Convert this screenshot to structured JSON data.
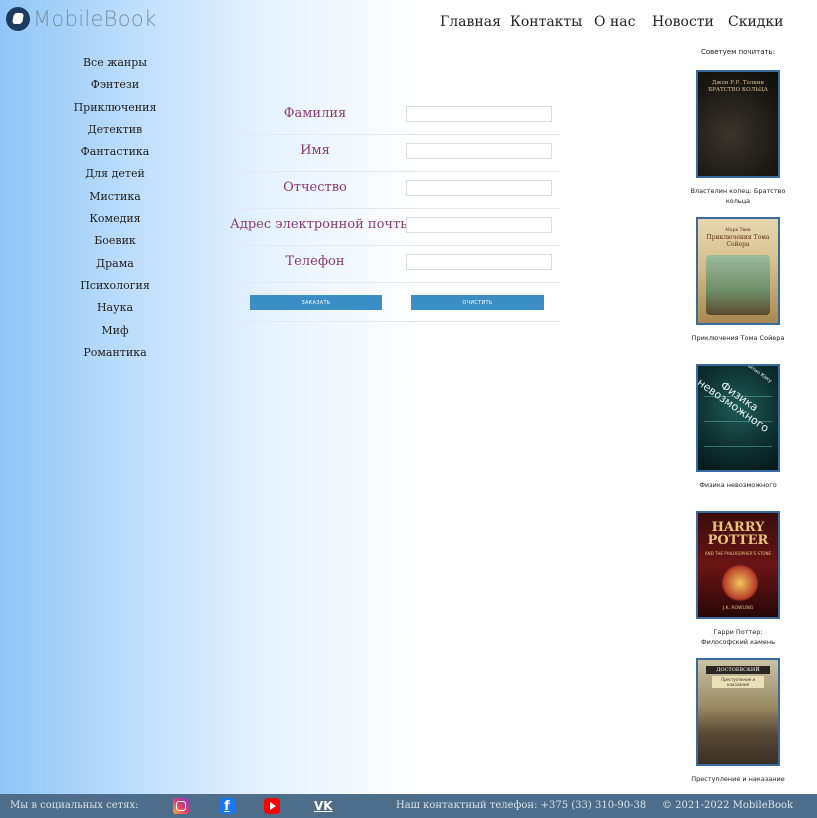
{
  "brand": {
    "name": "MobileBook"
  },
  "nav": [
    "Главная",
    "Контакты",
    "О нас",
    "Новости",
    "Скидки"
  ],
  "genres": [
    "Все жанры",
    "Фэнтези",
    "Приключения",
    "Детектив",
    "Фантастика",
    "Для детей",
    "Мистика",
    "Комедия",
    "Боевик",
    "Драма",
    "Психология",
    "Наука",
    "Миф",
    "Романтика"
  ],
  "form": {
    "fields": [
      {
        "label": "Фамилия",
        "value": ""
      },
      {
        "label": "Имя",
        "value": ""
      },
      {
        "label": "Отчество",
        "value": ""
      },
      {
        "label": "Адрес электронной почты",
        "value": ""
      },
      {
        "label": "Телефон",
        "value": ""
      }
    ],
    "order_label": "заказать",
    "clear_label": "очистить"
  },
  "recommend": {
    "title": "Советуем почитать:",
    "books": [
      {
        "caption": "Властелин колец: Братство кольца",
        "cover_text": "БРАТСТВО КОЛЬЦА",
        "cover_author": "Джон Р.Р. Толкин"
      },
      {
        "caption": "Приключения Тома Сойера",
        "cover_text": "Приключения Тома Сойера",
        "cover_author": "Марк Твен"
      },
      {
        "caption": "Физика невозможного",
        "cover_text": "Физика невозможного",
        "cover_author": "Митио Каку"
      },
      {
        "caption": "Гарри Поттер: Философский камень",
        "cover_text": "HARRY POTTER",
        "cover_subtitle": "AND THE PHILOSOPHER'S STONE",
        "cover_author": "J.K. ROWLING"
      },
      {
        "caption": "Преступление и наказание",
        "cover_text": "ДОСТОЕВСКИЙ",
        "cover_subtitle": "Преступление и наказание"
      }
    ]
  },
  "footer": {
    "social_label": "Мы в социальных сетях:",
    "phone": "Наш контактный телефон: +375 (33) 310-90-38",
    "copyright": "© 2021-2022 MobileBook"
  },
  "social_icons": [
    "instagram-icon",
    "facebook-icon",
    "youtube-icon",
    "vk-icon"
  ]
}
